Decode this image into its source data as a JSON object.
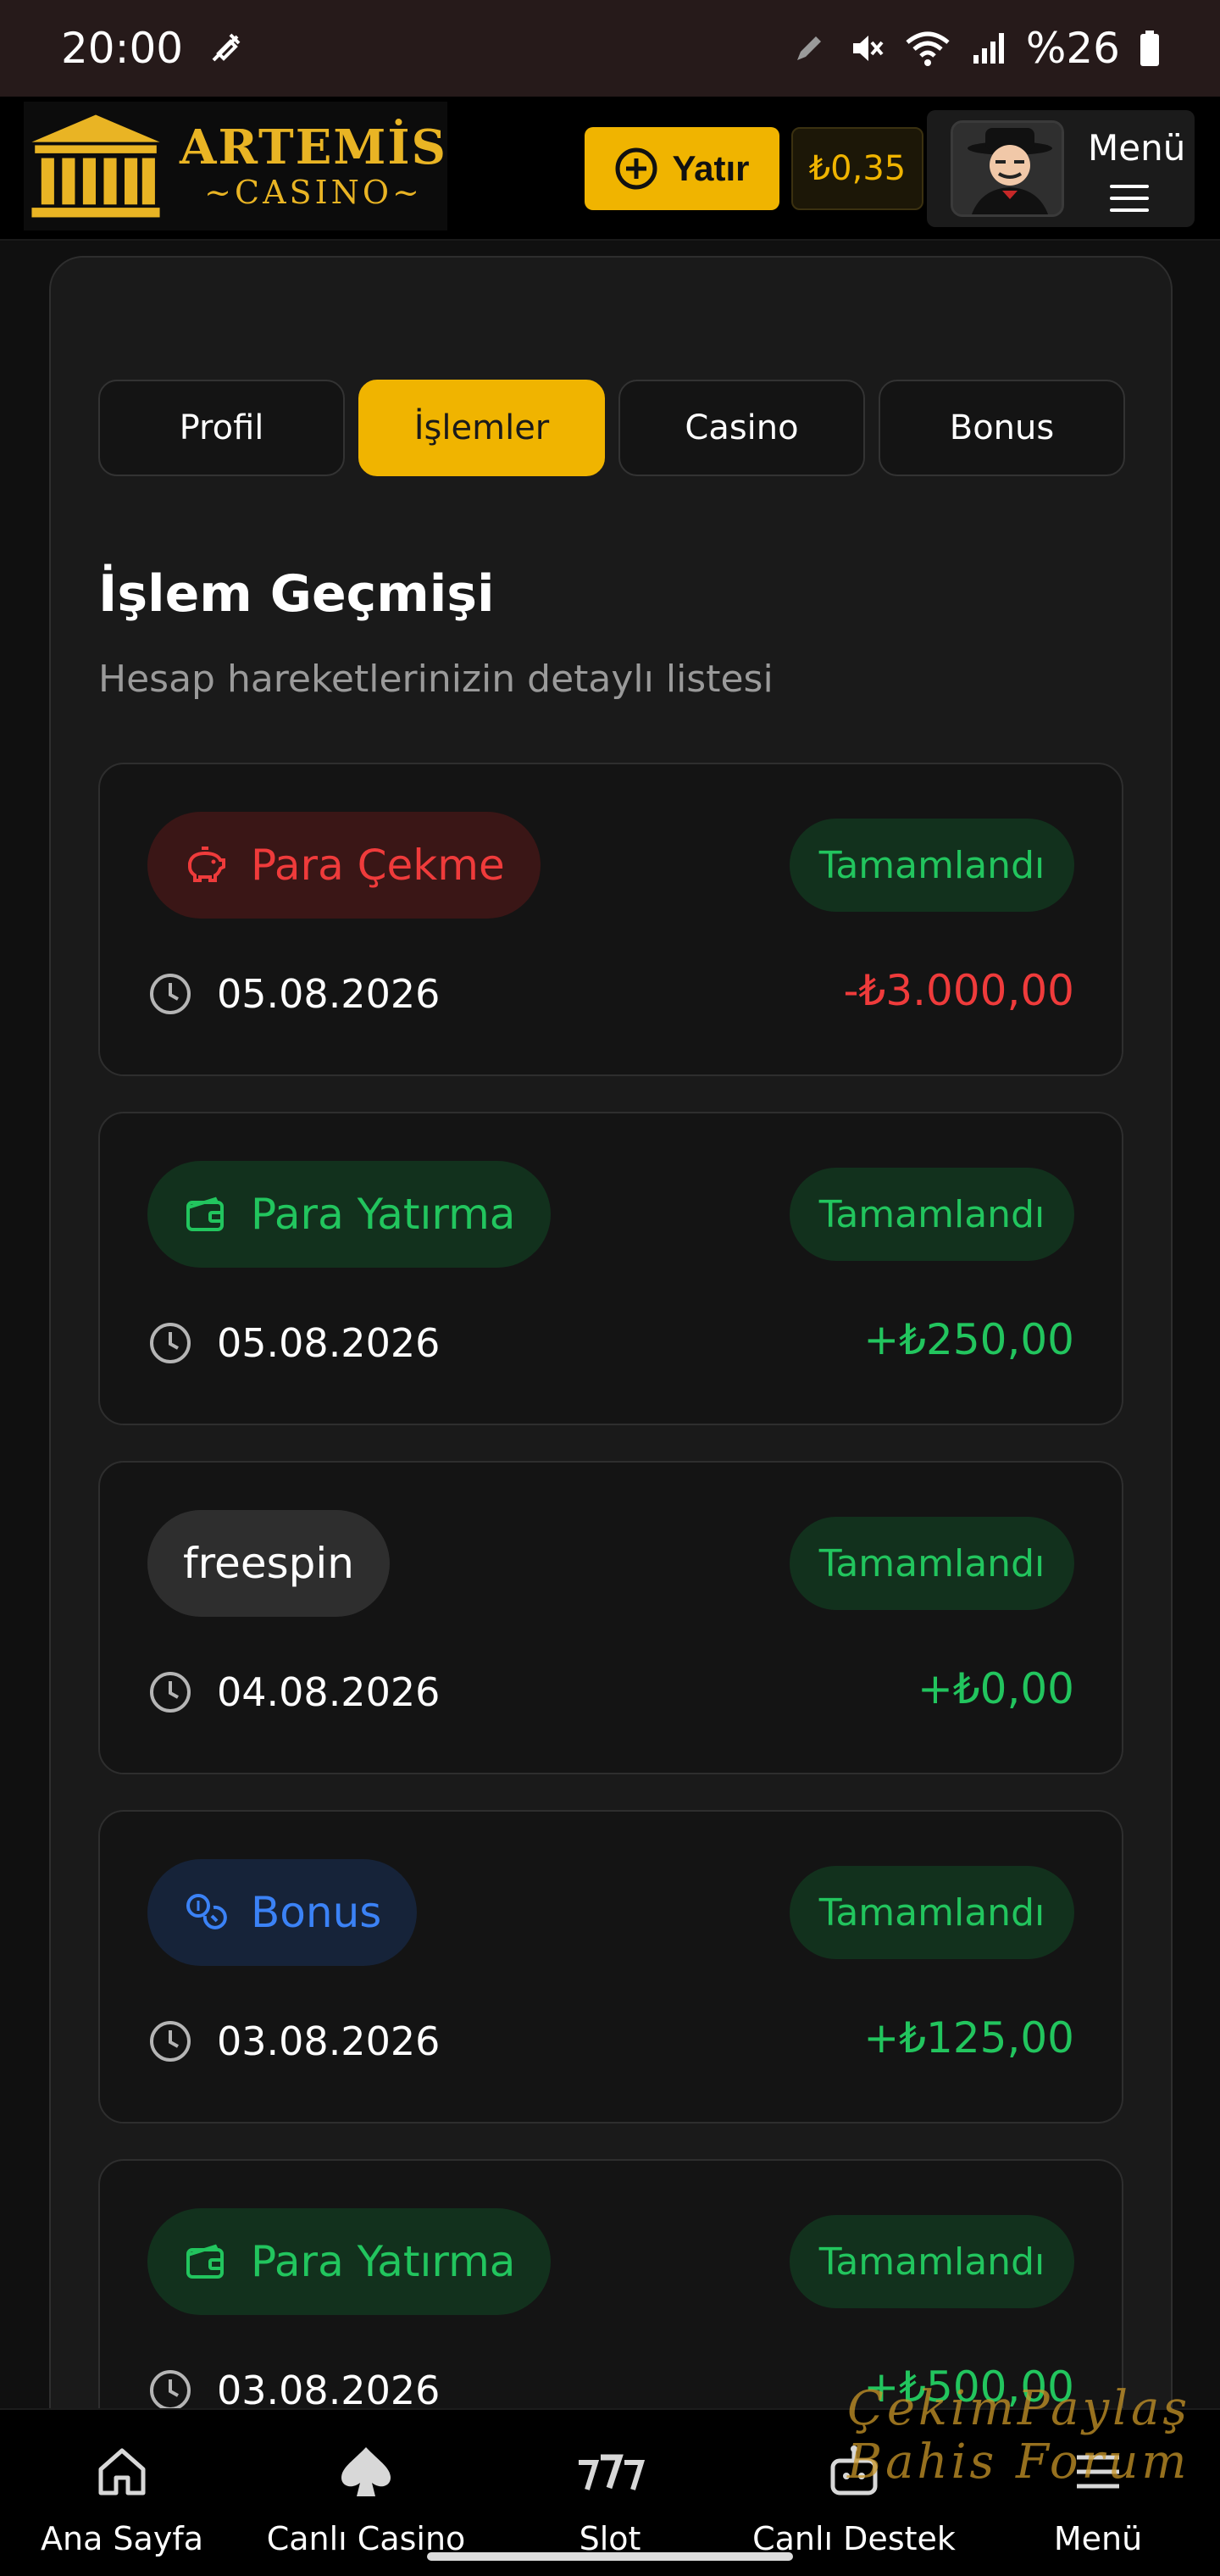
{
  "status_bar": {
    "time": "20:00",
    "battery": "%26",
    "icons": [
      "muted-ring-icon",
      "pen-icon",
      "mute-icon",
      "wifi-icon",
      "signal-icon",
      "battery-icon"
    ]
  },
  "header": {
    "logo_name": "ARTEMİS",
    "logo_sub": "CASINO",
    "deposit_label": "Yatır",
    "balance": "₺0,35",
    "menu_label": "Menü"
  },
  "tabs": [
    {
      "label": "Profil",
      "active": false
    },
    {
      "label": "İşlemler",
      "active": true
    },
    {
      "label": "Casino",
      "active": false
    },
    {
      "label": "Bonus",
      "active": false
    }
  ],
  "section": {
    "title": "İşlem Geçmişi",
    "subtitle": "Hesap hareketlerinizin detaylı listesi"
  },
  "transactions": [
    {
      "type": "Para Çekme",
      "kind": "withdraw",
      "icon": "piggy-bank-icon",
      "status": "Tamamlandı",
      "date": "05.08.2026",
      "amount": "-₺3.000,00"
    },
    {
      "type": "Para Yatırma",
      "kind": "deposit",
      "icon": "wallet-icon",
      "status": "Tamamlandı",
      "date": "05.08.2026",
      "amount": "+₺250,00"
    },
    {
      "type": "freespin",
      "kind": "freespin",
      "icon": "",
      "status": "Tamamlandı",
      "date": "04.08.2026",
      "amount": "+₺0,00"
    },
    {
      "type": "Bonus",
      "kind": "bonus",
      "icon": "coins-icon",
      "status": "Tamamlandı",
      "date": "03.08.2026",
      "amount": "+₺125,00"
    },
    {
      "type": "Para Yatırma",
      "kind": "deposit",
      "icon": "wallet-icon",
      "status": "Tamamlandı",
      "date": "03.08.2026",
      "amount": "+₺500,00"
    }
  ],
  "bottom_nav": [
    {
      "label": "Ana Sayfa",
      "icon": "home-icon"
    },
    {
      "label": "Canlı Casino",
      "icon": "spade-icon"
    },
    {
      "label": "Slot",
      "icon": "slot-777-icon"
    },
    {
      "label": "Canlı Destek",
      "icon": "support-bot-icon"
    },
    {
      "label": "Menü",
      "icon": "menu-icon"
    }
  ],
  "watermark": {
    "line1": "ÇekimPaylaş",
    "line2": "Bahis Forum"
  },
  "colors": {
    "accent": "#f0b400",
    "success": "#22c55e",
    "danger": "#ef3b3b",
    "info": "#3b82f6"
  }
}
